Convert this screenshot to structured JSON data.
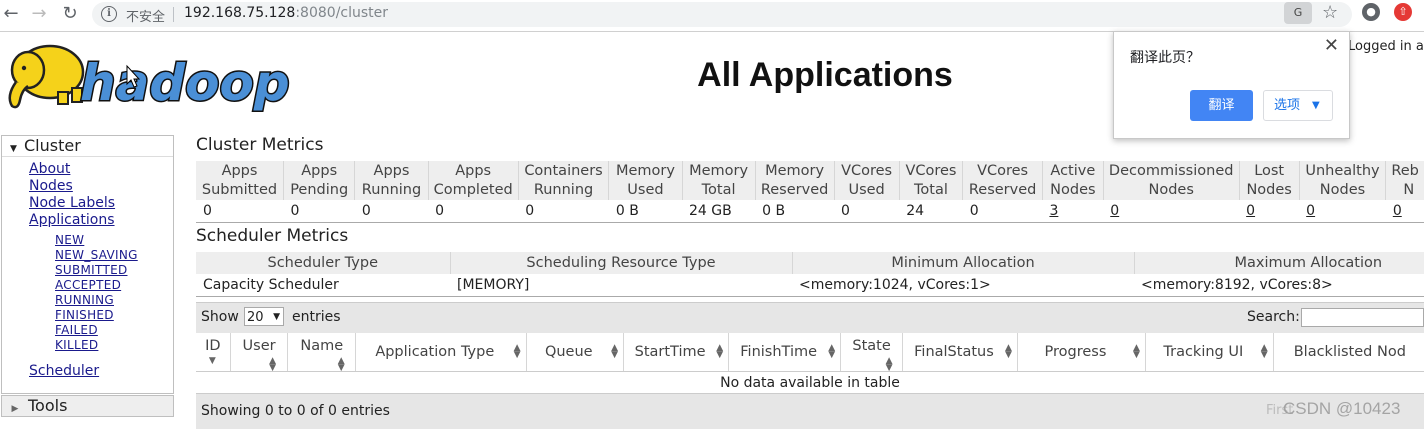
{
  "browser": {
    "security_label": "不安全",
    "url_host": "192.168.75.128",
    "url_rest": ":8080/cluster"
  },
  "header": {
    "logo_text": "hadoop",
    "title": "All Applications",
    "logged_in": "Logged in as"
  },
  "translate_popup": {
    "question": "翻译此页？",
    "translate_button": "翻译",
    "options_button": "选项"
  },
  "sidebar": {
    "cluster_label": "Cluster",
    "links": [
      "About",
      "Nodes",
      "Node Labels",
      "Applications"
    ],
    "app_states": [
      "NEW",
      "NEW_SAVING",
      "SUBMITTED",
      "ACCEPTED",
      "RUNNING",
      "FINISHED",
      "FAILED",
      "KILLED"
    ],
    "scheduler": "Scheduler",
    "tools_label": "Tools"
  },
  "cluster_metrics": {
    "title": "Cluster Metrics",
    "headers": [
      [
        "Apps",
        "Submitted"
      ],
      [
        "Apps",
        "Pending"
      ],
      [
        "Apps",
        "Running"
      ],
      [
        "Apps",
        "Completed"
      ],
      [
        "Containers",
        "Running"
      ],
      [
        "Memory",
        "Used"
      ],
      [
        "Memory",
        "Total"
      ],
      [
        "Memory",
        "Reserved"
      ],
      [
        "VCores",
        "Used"
      ],
      [
        "VCores",
        "Total"
      ],
      [
        "VCores",
        "Reserved"
      ],
      [
        "Active",
        "Nodes"
      ],
      [
        "Decommissioned",
        "Nodes"
      ],
      [
        "Lost",
        "Nodes"
      ],
      [
        "Unhealthy",
        "Nodes"
      ],
      [
        "Reb",
        "N"
      ]
    ],
    "values": [
      "0",
      "0",
      "0",
      "0",
      "0",
      "0 B",
      "24 GB",
      "0 B",
      "0",
      "24",
      "0",
      "3",
      "0",
      "0",
      "0",
      "0"
    ]
  },
  "scheduler_metrics": {
    "title": "Scheduler Metrics",
    "headers": [
      "Scheduler Type",
      "Scheduling Resource Type",
      "Minimum Allocation",
      "Maximum Allocation"
    ],
    "values": [
      "Capacity Scheduler",
      "[MEMORY]",
      "<memory:1024, vCores:1>",
      "<memory:8192, vCores:8>"
    ]
  },
  "apps_table": {
    "show_label": "Show",
    "page_size": "20",
    "entries_label": "entries",
    "search_label": "Search:",
    "columns": [
      "ID",
      "User",
      "Name",
      "Application Type",
      "Queue",
      "StartTime",
      "FinishTime",
      "State",
      "FinalStatus",
      "Progress",
      "Tracking UI",
      "Blacklisted Nod"
    ],
    "empty_message": "No data available in table",
    "info": "Showing 0 to 0 of 0 entries",
    "pager_first": "First"
  },
  "watermark": "CSDN @10423"
}
